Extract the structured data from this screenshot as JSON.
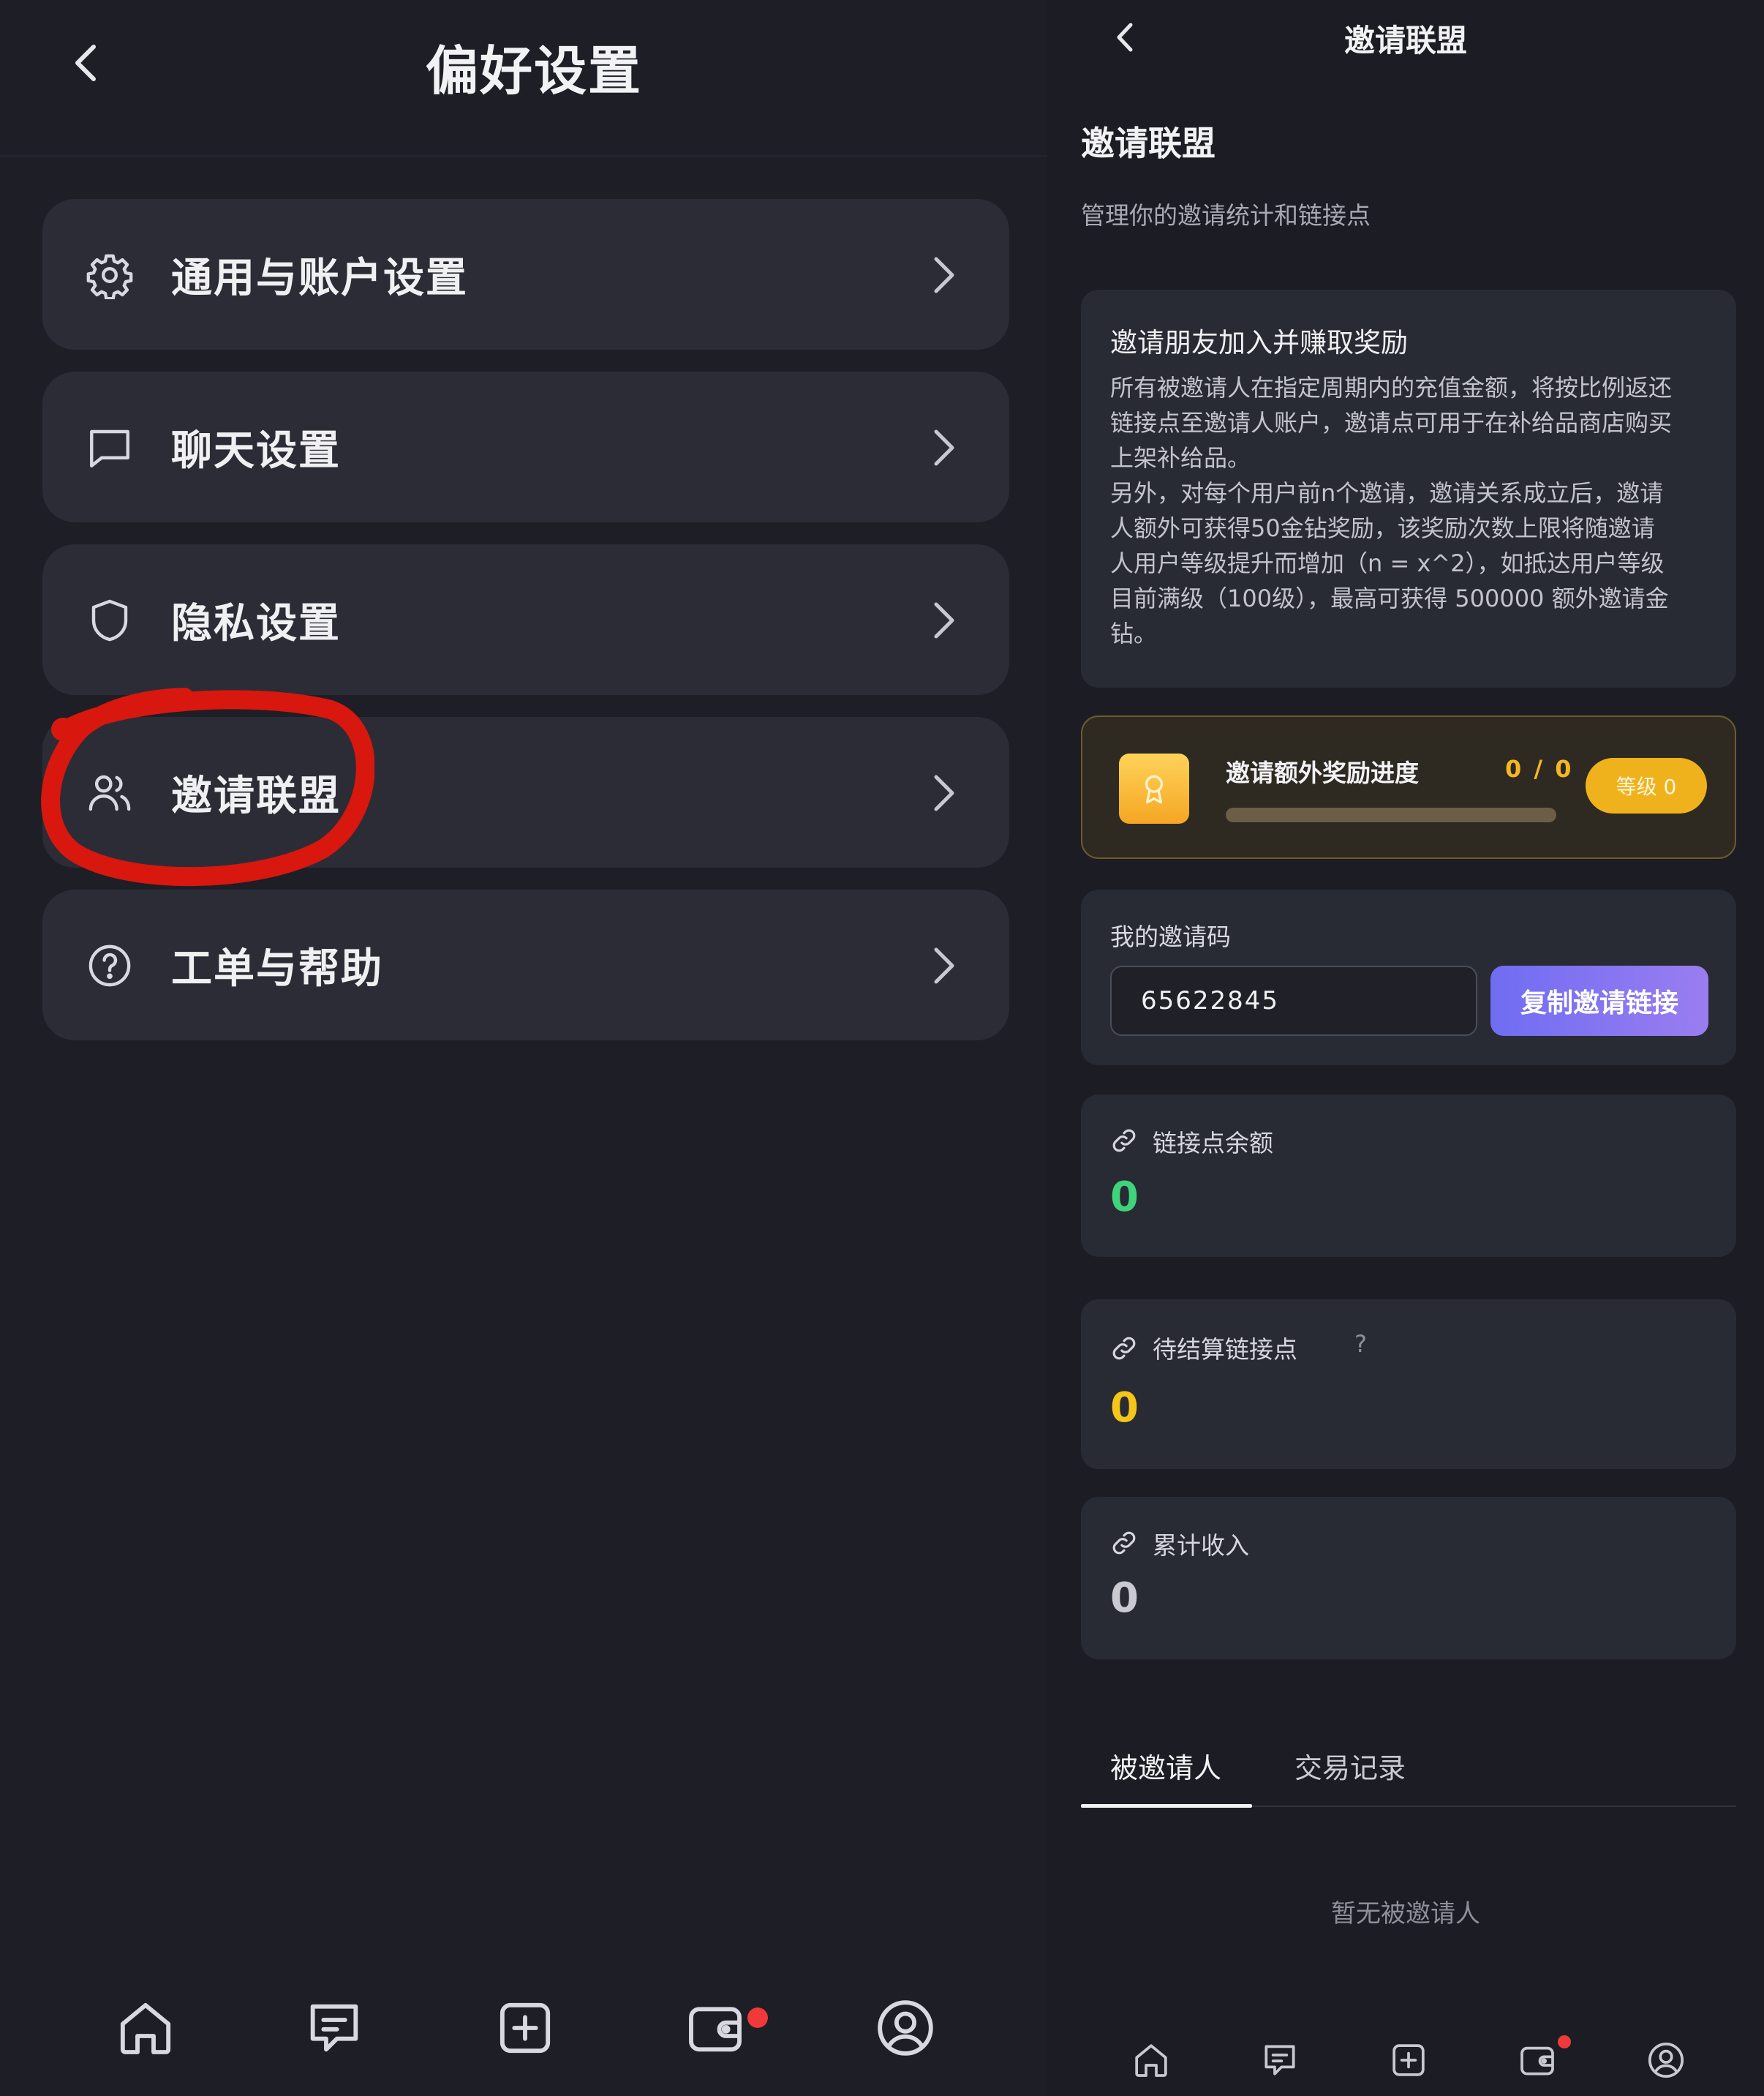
{
  "left_panel": {
    "title": "偏好设置",
    "menu": [
      {
        "label": "通用与账户设置",
        "icon": "gear-icon"
      },
      {
        "label": "聊天设置",
        "icon": "chat-bubble-icon"
      },
      {
        "label": "隐私设置",
        "icon": "shield-icon"
      },
      {
        "label": "邀请联盟",
        "icon": "users-icon"
      },
      {
        "label": "工单与帮助",
        "icon": "help-circle-icon"
      }
    ],
    "highlight_color": "#e0190f",
    "tabbar": [
      "home-icon",
      "message-icon",
      "add-icon",
      "wallet-icon",
      "profile-icon"
    ]
  },
  "right_panel": {
    "topbar_title": "邀请联盟",
    "page_title": "邀请联盟",
    "page_subtitle": "管理你的邀请统计和链接点",
    "intro": {
      "title": "邀请朋友加入并赚取奖励",
      "body": "所有被邀请人在指定周期内的充值金额，将按比例返还\n链接点至邀请人账户，邀请点可用于在补给品商店购买\n上架补给品。\n另外，对每个用户前n个邀请，邀请关系成立后，邀请\n人额外可获得50金钻奖励，该奖励次数上限将随邀请\n人用户等级提升而增加（n = x^2），如抵达用户等级\n目前满级（100级），最高可获得 500000 额外邀请金\n钻。"
    },
    "progress": {
      "title": "邀请额外奖励进度",
      "count": "0 / 0",
      "fraction": 0,
      "level": "等级 0"
    },
    "invite_code": {
      "label": "我的邀请码",
      "value": "65622845",
      "copy_button": "复制邀请链接"
    },
    "stats": [
      {
        "label": "链接点余额",
        "value": "0",
        "color": "#3fd47b"
      },
      {
        "label": "待结算链接点",
        "value": "0",
        "color": "#f5c518",
        "help": "?"
      },
      {
        "label": "累计收入",
        "value": "0",
        "color": "#c9cad2"
      }
    ],
    "tabs": [
      "被邀请人",
      "交易记录"
    ],
    "empty_text": "暂无被邀请人",
    "accent_colors": {
      "primary": "#7b74f0",
      "gold": "#f5b623",
      "green": "#3fd47b"
    }
  }
}
